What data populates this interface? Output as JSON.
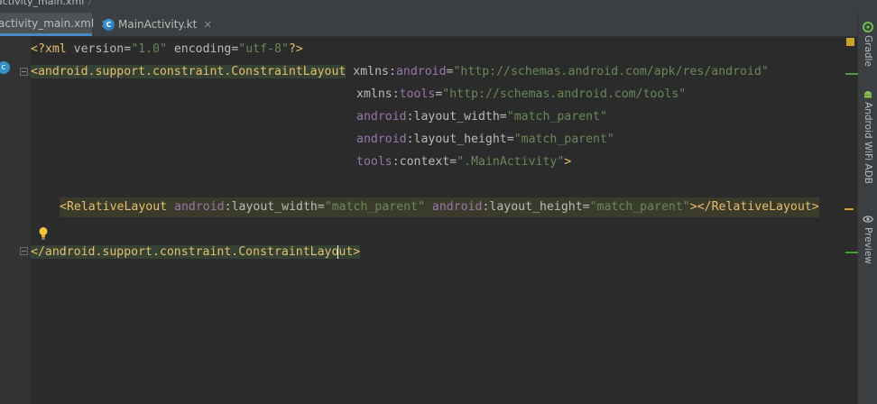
{
  "breadcrumb": {
    "text": "activity_main.xml"
  },
  "tabs": [
    {
      "label": "activity_main.xml",
      "close": "×"
    },
    {
      "label": "MainActivity.kt",
      "close": "×"
    }
  ],
  "tool_windows": [
    {
      "label": "Gradle",
      "icon": "gradle-icon"
    },
    {
      "label": "Android WiFi ADB",
      "icon": "android-icon"
    },
    {
      "label": "Preview",
      "icon": "eye-icon"
    }
  ],
  "code": {
    "l1": {
      "open": "<?",
      "name": "xml",
      "a1": " version=",
      "v1": "\"1.0\"",
      "a2": " encoding=",
      "v2": "\"utf-8\"",
      "close": "?>"
    },
    "l2": {
      "tag": "<android.support.constraint.ConstraintLayout",
      "ns": "xmlns:",
      "attr": "android",
      "eq": "=",
      "val": "\"http://schemas.android.com/apk/res/android\""
    },
    "l3": {
      "ns": "xmlns:",
      "attr": "tools",
      "eq": "=",
      "val": "\"http://schemas.android.com/tools\""
    },
    "l4": {
      "ns": "android",
      "attr": ":layout_width",
      "eq": "=",
      "val": "\"match_parent\""
    },
    "l5": {
      "ns": "android",
      "attr": ":layout_height",
      "eq": "=",
      "val": "\"match_parent\""
    },
    "l6": {
      "ns": "tools",
      "attr": ":context",
      "eq": "=",
      "val": "\".MainActivity\"",
      "close": ">"
    },
    "l8": {
      "tag": "<RelativeLayout",
      "ns1": " android",
      "attr1": ":layout_width",
      "eq1": "=",
      "val1": "\"match_parent\"",
      "ns2": " android",
      "attr2": ":layout_height",
      "eq2": "=",
      "val2": "\"match_parent\"",
      "close": "></RelativeLayout>"
    },
    "l10": {
      "tag_a": "</android.support.constraint.ConstraintLayo",
      "tag_b": "ut",
      "close": ">"
    }
  },
  "colors": {
    "tag": "#e8bf6a",
    "value": "#6a8759",
    "namespace": "#9876aa",
    "background": "#2b2b2b",
    "tab_underline": "#4a88c7"
  }
}
